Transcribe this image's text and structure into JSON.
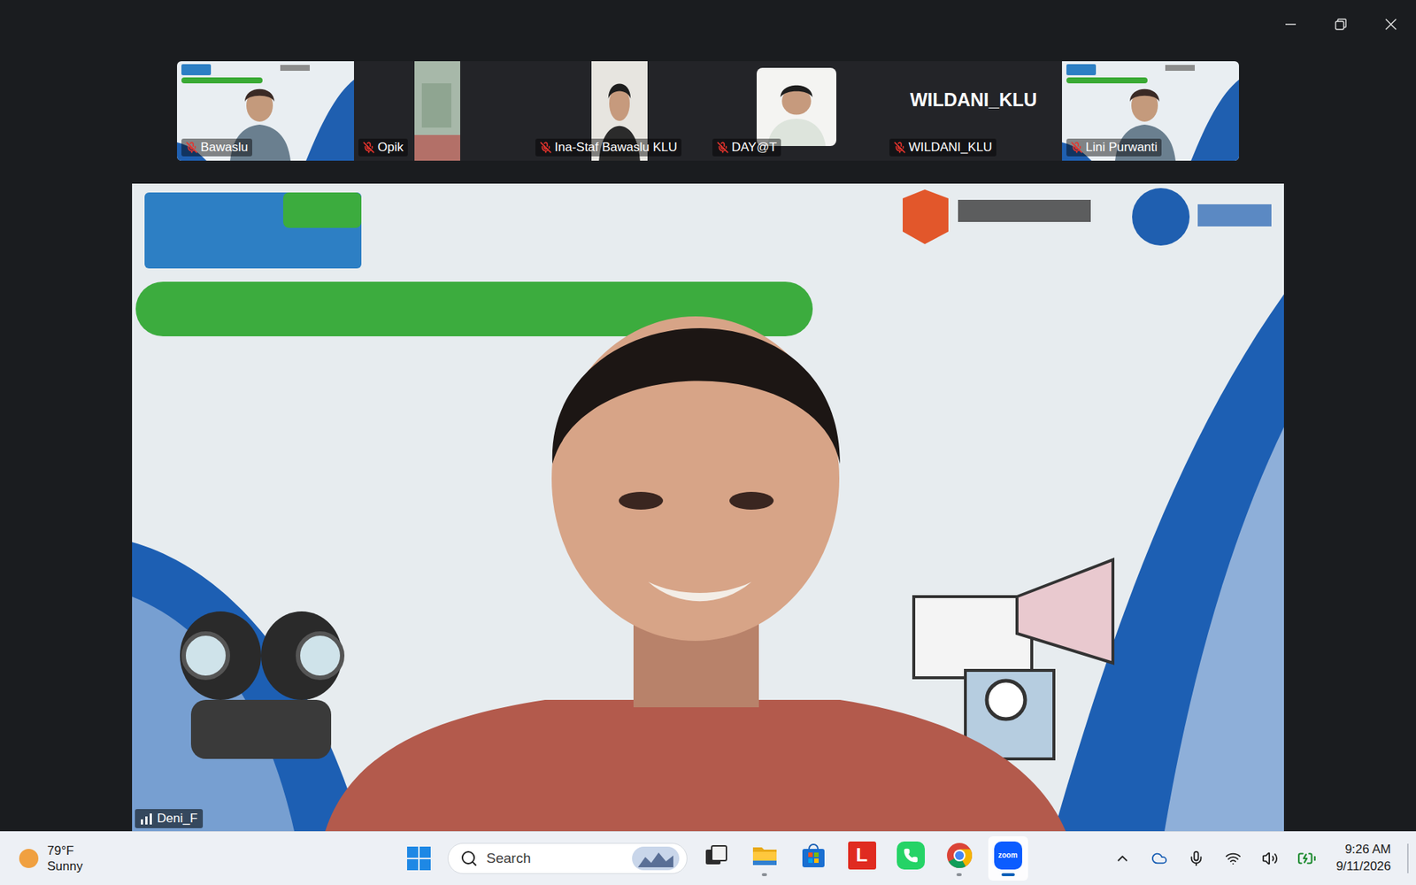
{
  "meeting": {
    "participants": [
      {
        "name": "Bawaslu",
        "muted": true,
        "kind": "slide-video"
      },
      {
        "name": "Opik",
        "muted": true,
        "kind": "partial-video"
      },
      {
        "name": "Ina-Staf Bawaslu KLU",
        "muted": true,
        "kind": "portrait-video"
      },
      {
        "name": "DAY@T",
        "muted": true,
        "kind": "framed-video"
      },
      {
        "name": "WILDANI_KLU",
        "muted": true,
        "kind": "name-only"
      },
      {
        "name": "Lini Purwanti",
        "muted": true,
        "kind": "slide-video"
      }
    ],
    "active_speaker": {
      "name": "Deni_F"
    }
  },
  "taskbar": {
    "weather": {
      "temperature": "79°F",
      "condition": "Sunny"
    },
    "search": {
      "placeholder": "Search"
    },
    "apps": [
      {
        "kind": "taskview",
        "label": "",
        "running": false,
        "selected": false
      },
      {
        "kind": "explorer",
        "label": "",
        "running": true,
        "selected": false
      },
      {
        "kind": "store",
        "label": "",
        "running": false,
        "selected": false
      },
      {
        "kind": "letter",
        "label": "L",
        "running": false,
        "selected": false
      },
      {
        "kind": "whatsapp",
        "label": "",
        "running": false,
        "selected": false
      },
      {
        "kind": "chrome",
        "label": "",
        "running": true,
        "selected": false
      },
      {
        "kind": "zoom",
        "label": "zoom",
        "running": true,
        "selected": true
      }
    ],
    "clock": {
      "time": "9:26 AM",
      "date": "9/11/2026"
    }
  }
}
